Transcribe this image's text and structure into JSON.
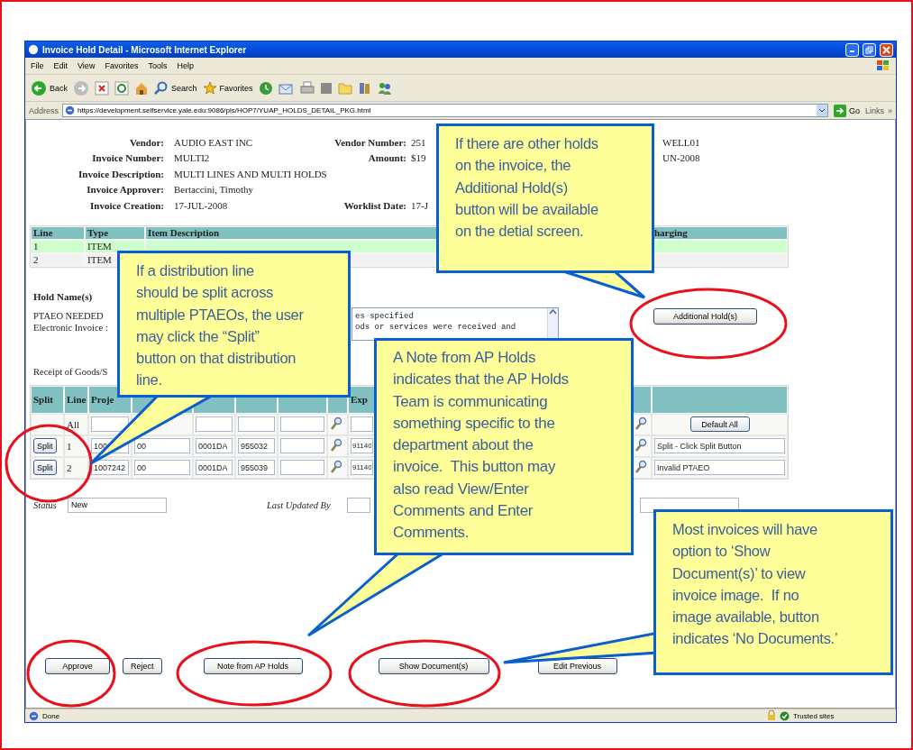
{
  "window": {
    "title": "Invoice Hold Detail - Microsoft Internet Explorer"
  },
  "menu": [
    "File",
    "Edit",
    "View",
    "Favorites",
    "Tools",
    "Help"
  ],
  "toolbar": [
    {
      "kind": "back",
      "label": "Back"
    },
    {
      "kind": "forward"
    },
    {
      "kind": "stop"
    },
    {
      "kind": "refresh"
    },
    {
      "kind": "home"
    },
    {
      "kind": "search",
      "label": "Search"
    },
    {
      "kind": "favorites",
      "label": "Favorites"
    },
    {
      "kind": "history"
    },
    {
      "kind": "mail"
    },
    {
      "kind": "print"
    },
    {
      "kind": "edit"
    },
    {
      "kind": "folder"
    },
    {
      "kind": "research"
    },
    {
      "kind": "messenger"
    }
  ],
  "address": {
    "label": "Address",
    "url": "https://development.selfservice.yale.edu:9086/pls/HOP7/YUAP_HOLDS_DETAIL_PKG.html",
    "go": "Go",
    "links": "Links",
    "more": "»"
  },
  "header": {
    "rows": [
      {
        "label": "Vendor:",
        "value": "AUDIO EAST INC",
        "label_2": "Vendor Number:",
        "value_2": "251",
        "value_3": "WELL01"
      },
      {
        "label": "Invoice Number:",
        "value": "MULTI2",
        "label_2": "Amount:",
        "value_2": "$19",
        "value_3": "UN-2008"
      },
      {
        "label": "Invoice Description:",
        "value": "MULTI LINES AND MULTI HOLDS"
      },
      {
        "label": "Invoice Approver:",
        "value": "Bertaccini, Timothy"
      },
      {
        "label": "Invoice Creation:",
        "value": "17-JUL-2008",
        "label_2": "Worklist Date:",
        "value_2": "17-J"
      }
    ]
  },
  "items_table": {
    "columns": [
      "Line",
      "Type",
      "Item Description",
      "harging"
    ],
    "rows": [
      {
        "line": "1",
        "type": "ITEM",
        "highlighted": true
      },
      {
        "line": "2",
        "type": "ITEM",
        "highlighted": false
      }
    ]
  },
  "holds": {
    "title": "Hold Name(s)",
    "names": [
      "PTAEO NEEDED",
      "Electronic Invoice :"
    ],
    "comments": [
      "es specified",
      "ods or services were received and"
    ],
    "button": "Additional Hold(s)"
  },
  "receipt_label": "Receipt of Goods/S",
  "distribution_table": {
    "columns": [
      "Split",
      "Line",
      "Proje",
      "Exp"
    ],
    "rows": [
      {
        "kind": "defaults",
        "line": "All",
        "action": "Default All"
      },
      {
        "kind": "line",
        "split": "Split",
        "line": "1",
        "project": "100",
        "task": "00",
        "org": "0001DA",
        "award": "955032",
        "exp_type": "91140",
        "status": "Split - Click Split Button"
      },
      {
        "kind": "line",
        "split": "Split",
        "line": "2",
        "project": "1007242",
        "task": "00",
        "org": "0001DA",
        "award": "955039",
        "exp_type": "91140",
        "status": "Invalid PTAEO"
      }
    ]
  },
  "status_row": {
    "status_label": "Status",
    "status_value": "New",
    "updated_label": "Last Updated By"
  },
  "buttons": [
    "Approve",
    "Reject",
    "Note from AP Holds",
    "Show Document(s)",
    "Edit Previous"
  ],
  "status_bar": {
    "text": "Done",
    "zone": "Trusted sites"
  },
  "callouts": [
    {
      "text": "If there are other holds\non the invoice, the\nAdditional Hold(s)\nbutton will be available\non the detial screen."
    },
    {
      "text": "If a distribution line\nshould be split across\nmultiple PTAEOs, the user\nmay click the “Split”\nbutton on that distribution\nline."
    },
    {
      "text": "A Note from AP Holds\nindicates that the AP Holds\nTeam is communicating\nsomething specific to the\ndepartment about the\ninvoice.  This button may\nalso read View/Enter\nComments and Enter\nComments."
    },
    {
      "text": "Most invoices will have\noption to ‘Show\nDocument(s)’ to view\ninvoice image.  If no\nimage available, button\nindicates ‘No Documents.’"
    }
  ]
}
